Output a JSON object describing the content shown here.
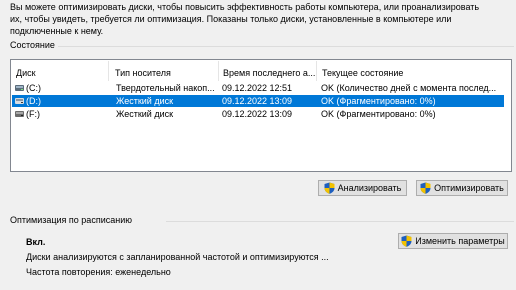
{
  "intro_text": "Вы можете оптимизировать диски, чтобы повысить эффективность работы  компьютера, или проанализировать\nих, чтобы увидеть, требуется ли оптимизация. Показаны только диски, установленные в компьютере или\nподключенные к нему.",
  "status_section": {
    "label": "Состояние"
  },
  "columns": [
    "Диск",
    "Тип носителя",
    "Время последнего а...",
    "Текущее состояние"
  ],
  "drives": [
    {
      "drive": "(C:)",
      "media": "Твердотельный накоп...",
      "last": "09.12.2022 12:51",
      "state": "OK (Количество дней с момента послед...",
      "icon": "ssd-drive-icon"
    },
    {
      "drive": "(D:)",
      "media": "Жесткий диск",
      "last": "09.12.2022 13:09",
      "state": "OK (Фрагментировано: 0%)",
      "icon": "hdd-drive-icon",
      "selected": true
    },
    {
      "drive": "(F:)",
      "media": "Жесткий диск",
      "last": "09.12.2022 13:09",
      "state": "OK (Фрагментировано: 0%)",
      "icon": "hdd-drive-icon"
    }
  ],
  "buttons": {
    "analyze": "Анализировать",
    "optimize": "Оптимизировать",
    "change_settings": "Изменить параметры"
  },
  "schedule": {
    "label": "Оптимизация по расписанию",
    "status": "Вкл.",
    "description": "Диски анализируются с запланированной частотой и оптимизируются ...",
    "frequency": "Частота повторения: еженедельно"
  },
  "colors": {
    "selection": "#0078d7",
    "window_bg": "#f0f0f0",
    "button_bg": "#e1e1e1"
  }
}
